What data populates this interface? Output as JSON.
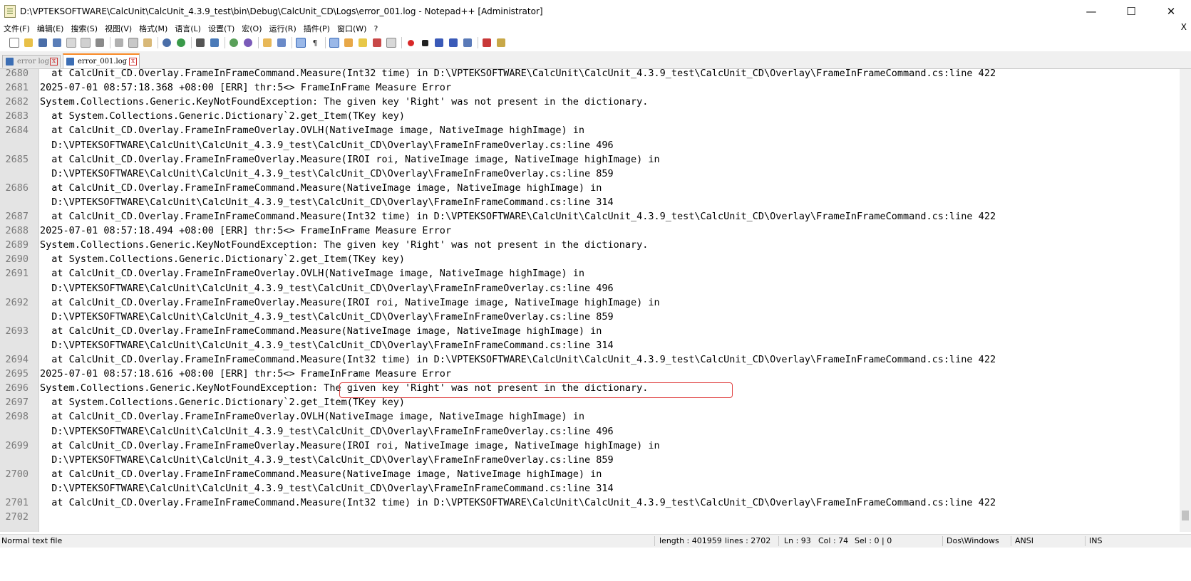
{
  "window": {
    "title": "D:\\VPTEKSOFTWARE\\CalcUnit\\CalcUnit_4.3.9_test\\bin\\Debug\\CalcUnit_CD\\Logs\\error_001.log - Notepad++ [Administrator]",
    "minimize": "—",
    "maximize": "☐",
    "close": "✕"
  },
  "menu": {
    "items": [
      "文件(F)",
      "编辑(E)",
      "搜索(S)",
      "视图(V)",
      "格式(M)",
      "语言(L)",
      "设置(T)",
      "宏(O)",
      "运行(R)",
      "插件(P)",
      "窗口(W)",
      "?"
    ],
    "close": "X"
  },
  "tabs": [
    {
      "label": "error log",
      "active": false
    },
    {
      "label": "error_001.log",
      "active": true
    }
  ],
  "editor": {
    "lines": [
      {
        "num": "2680",
        "text": "  at CalcUnit_CD.Overlay.FrameInFrameCommand.Measure(Int32 time) in D:\\VPTEKSOFTWARE\\CalcUnit\\CalcUnit_4.3.9_test\\CalcUnit_CD\\Overlay\\FrameInFrameCommand.cs:line 422"
      },
      {
        "num": "2681",
        "text": "2025-07-01 08:57:18.368 +08:00 [ERR] thr:5<> FrameInFrame Measure Error"
      },
      {
        "num": "2682",
        "text": "System.Collections.Generic.KeyNotFoundException: The given key 'Right' was not present in the dictionary."
      },
      {
        "num": "2683",
        "text": "  at System.Collections.Generic.Dictionary`2.get_Item(TKey key)"
      },
      {
        "num": "2684",
        "text": "  at CalcUnit_CD.Overlay.FrameInFrameOverlay.OVLH(NativeImage image, NativeImage highImage) in"
      },
      {
        "num": "",
        "text": "  D:\\VPTEKSOFTWARE\\CalcUnit\\CalcUnit_4.3.9_test\\CalcUnit_CD\\Overlay\\FrameInFrameOverlay.cs:line 496"
      },
      {
        "num": "2685",
        "text": "  at CalcUnit_CD.Overlay.FrameInFrameOverlay.Measure(IROI roi, NativeImage image, NativeImage highImage) in"
      },
      {
        "num": "",
        "text": "  D:\\VPTEKSOFTWARE\\CalcUnit\\CalcUnit_4.3.9_test\\CalcUnit_CD\\Overlay\\FrameInFrameOverlay.cs:line 859"
      },
      {
        "num": "2686",
        "text": "  at CalcUnit_CD.Overlay.FrameInFrameCommand.Measure(NativeImage image, NativeImage highImage) in"
      },
      {
        "num": "",
        "text": "  D:\\VPTEKSOFTWARE\\CalcUnit\\CalcUnit_4.3.9_test\\CalcUnit_CD\\Overlay\\FrameInFrameCommand.cs:line 314"
      },
      {
        "num": "2687",
        "text": "  at CalcUnit_CD.Overlay.FrameInFrameCommand.Measure(Int32 time) in D:\\VPTEKSOFTWARE\\CalcUnit\\CalcUnit_4.3.9_test\\CalcUnit_CD\\Overlay\\FrameInFrameCommand.cs:line 422"
      },
      {
        "num": "2688",
        "text": "2025-07-01 08:57:18.494 +08:00 [ERR] thr:5<> FrameInFrame Measure Error"
      },
      {
        "num": "2689",
        "text": "System.Collections.Generic.KeyNotFoundException: The given key 'Right' was not present in the dictionary."
      },
      {
        "num": "2690",
        "text": "  at System.Collections.Generic.Dictionary`2.get_Item(TKey key)"
      },
      {
        "num": "2691",
        "text": "  at CalcUnit_CD.Overlay.FrameInFrameOverlay.OVLH(NativeImage image, NativeImage highImage) in"
      },
      {
        "num": "",
        "text": "  D:\\VPTEKSOFTWARE\\CalcUnit\\CalcUnit_4.3.9_test\\CalcUnit_CD\\Overlay\\FrameInFrameOverlay.cs:line 496"
      },
      {
        "num": "2692",
        "text": "  at CalcUnit_CD.Overlay.FrameInFrameOverlay.Measure(IROI roi, NativeImage image, NativeImage highImage) in"
      },
      {
        "num": "",
        "text": "  D:\\VPTEKSOFTWARE\\CalcUnit\\CalcUnit_4.3.9_test\\CalcUnit_CD\\Overlay\\FrameInFrameOverlay.cs:line 859"
      },
      {
        "num": "2693",
        "text": "  at CalcUnit_CD.Overlay.FrameInFrameCommand.Measure(NativeImage image, NativeImage highImage) in"
      },
      {
        "num": "",
        "text": "  D:\\VPTEKSOFTWARE\\CalcUnit\\CalcUnit_4.3.9_test\\CalcUnit_CD\\Overlay\\FrameInFrameCommand.cs:line 314"
      },
      {
        "num": "2694",
        "text": "  at CalcUnit_CD.Overlay.FrameInFrameCommand.Measure(Int32 time) in D:\\VPTEKSOFTWARE\\CalcUnit\\CalcUnit_4.3.9_test\\CalcUnit_CD\\Overlay\\FrameInFrameCommand.cs:line 422"
      },
      {
        "num": "2695",
        "text": "2025-07-01 08:57:18.616 +08:00 [ERR] thr:5<> FrameInFrame Measure Error"
      },
      {
        "num": "2696",
        "text": "System.Collections.Generic.KeyNotFoundException: The given key 'Right' was not present in the dictionary."
      },
      {
        "num": "2697",
        "text": "  at System.Collections.Generic.Dictionary`2.get_Item(TKey key)"
      },
      {
        "num": "2698",
        "text": "  at CalcUnit_CD.Overlay.FrameInFrameOverlay.OVLH(NativeImage image, NativeImage highImage) in"
      },
      {
        "num": "",
        "text": "  D:\\VPTEKSOFTWARE\\CalcUnit\\CalcUnit_4.3.9_test\\CalcUnit_CD\\Overlay\\FrameInFrameOverlay.cs:line 496"
      },
      {
        "num": "2699",
        "text": "  at CalcUnit_CD.Overlay.FrameInFrameOverlay.Measure(IROI roi, NativeImage image, NativeImage highImage) in"
      },
      {
        "num": "",
        "text": "  D:\\VPTEKSOFTWARE\\CalcUnit\\CalcUnit_4.3.9_test\\CalcUnit_CD\\Overlay\\FrameInFrameOverlay.cs:line 859"
      },
      {
        "num": "2700",
        "text": "  at CalcUnit_CD.Overlay.FrameInFrameCommand.Measure(NativeImage image, NativeImage highImage) in"
      },
      {
        "num": "",
        "text": "  D:\\VPTEKSOFTWARE\\CalcUnit\\CalcUnit_4.3.9_test\\CalcUnit_CD\\Overlay\\FrameInFrameCommand.cs:line 314"
      },
      {
        "num": "2701",
        "text": "  at CalcUnit_CD.Overlay.FrameInFrameCommand.Measure(Int32 time) in D:\\VPTEKSOFTWARE\\CalcUnit\\CalcUnit_4.3.9_test\\CalcUnit_CD\\Overlay\\FrameInFrameCommand.cs:line 422"
      },
      {
        "num": "2702",
        "text": ""
      }
    ]
  },
  "status": {
    "file_type": "Normal text file",
    "length": "length : 401959",
    "lines": "lines : 2702",
    "ln": "Ln : 93",
    "col": "Col : 74",
    "sel": "Sel : 0 | 0",
    "eol": "Dos\\Windows",
    "encoding": "ANSI",
    "mode": "INS"
  },
  "colors": {
    "active_tab_accent": "#fa8b28",
    "highlight_box": "#e04343",
    "gutter_bg": "#e4e4e4"
  }
}
